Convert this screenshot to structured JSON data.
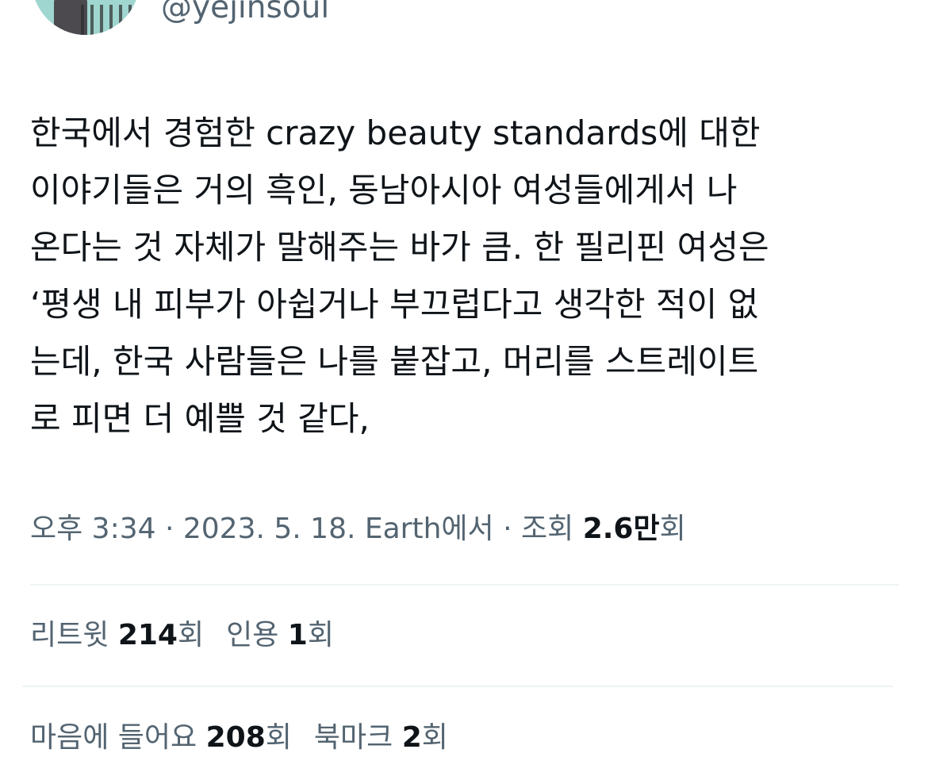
{
  "user": {
    "handle": "@yejinsoul"
  },
  "tweet": {
    "lines": [
      "한국에서 경험한 crazy beauty standards에 대한",
      "이야기들은 거의 흑인, 동남아시아 여성들에게서 나",
      "온다는 것 자체가 말해주는 바가 큼. 한 필리핀 여성은",
      "‘평생 내 피부가 아쉽거나 부끄럽다고 생각한 적이 없",
      "는데, 한국 사람들은 나를 붙잡고, 머리를 스트레이트",
      "로 피면 더 예쁠 것 같다,"
    ]
  },
  "meta": {
    "time": "오후 3:34",
    "sep1": " · ",
    "date": "2023. 5. 18.",
    "source": " Earth에서",
    "sep2": " · ",
    "views_label": "조회 ",
    "views_value": "2.6만",
    "views_suffix": "회"
  },
  "stats": {
    "retweets_label": "리트윗 ",
    "retweets_value": "214",
    "retweets_suffix": "회",
    "quotes_label": "인용 ",
    "quotes_value": "1",
    "quotes_suffix": "회",
    "likes_label": "마음에 들어요 ",
    "likes_value": "208",
    "likes_suffix": "회",
    "bookmarks_label": "북마크 ",
    "bookmarks_value": "2",
    "bookmarks_suffix": "회"
  }
}
